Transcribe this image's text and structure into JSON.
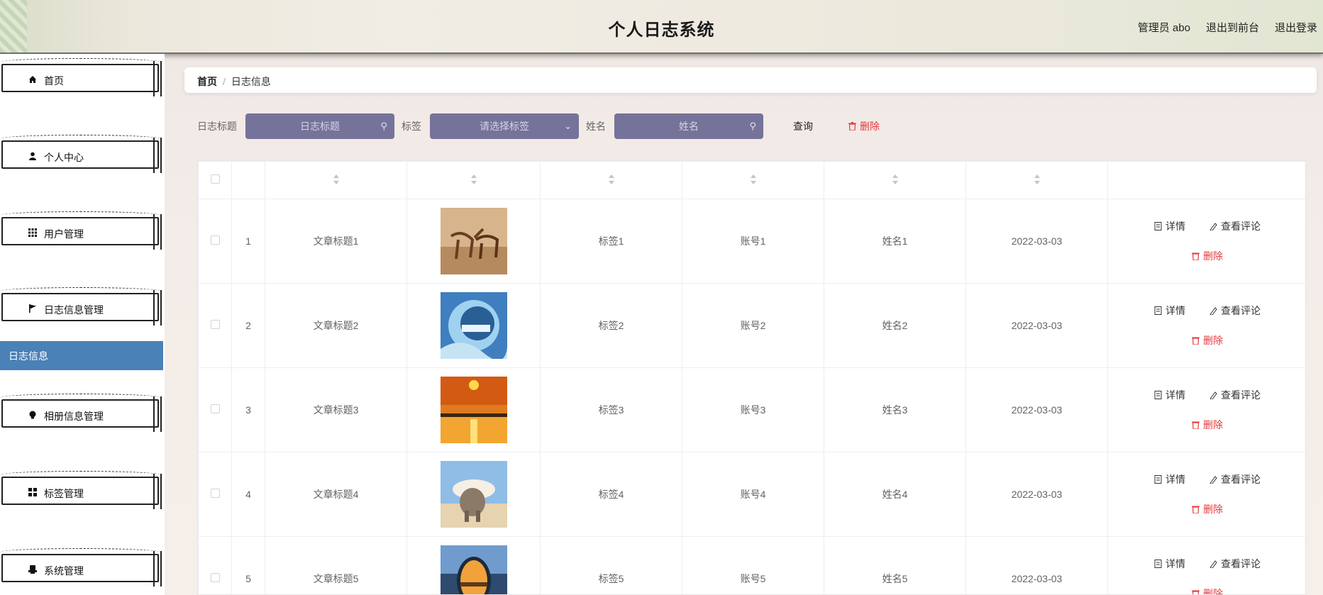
{
  "header": {
    "title": "个人日志系统",
    "user": "管理员 abo",
    "to_front": "退出到前台",
    "logout": "退出登录"
  },
  "sidebar": {
    "items": [
      {
        "label": "首页",
        "icon": "home-icon"
      },
      {
        "label": "个人中心",
        "icon": "user-icon"
      },
      {
        "label": "用户管理",
        "icon": "grid-icon"
      },
      {
        "label": "日志信息管理",
        "icon": "flag-icon"
      },
      {
        "label": "相册信息管理",
        "icon": "bulb-icon"
      },
      {
        "label": "标签管理",
        "icon": "apps-icon"
      },
      {
        "label": "系统管理",
        "icon": "print-icon"
      }
    ],
    "active_sub": "日志信息"
  },
  "breadcrumb": {
    "home": "首页",
    "sep": "/",
    "current": "日志信息"
  },
  "search": {
    "title_label": "日志标题",
    "title_placeholder": "日志标题",
    "tag_label": "标签",
    "tag_placeholder": "请选择标签",
    "name_label": "姓名",
    "name_placeholder": "姓名",
    "query": "查询",
    "delete": "删除"
  },
  "table": {
    "rows": [
      {
        "idx": "1",
        "title": "文章标题1",
        "image": "gazelles",
        "tag": "标签1",
        "account": "账号1",
        "name": "姓名1",
        "date": "2022-03-03"
      },
      {
        "idx": "2",
        "title": "文章标题2",
        "image": "water-wave",
        "tag": "标签2",
        "account": "账号2",
        "name": "姓名2",
        "date": "2022-03-03"
      },
      {
        "idx": "3",
        "title": "文章标题3",
        "image": "sunset-lake",
        "tag": "标签3",
        "account": "账号3",
        "name": "姓名3",
        "date": "2022-03-03"
      },
      {
        "idx": "4",
        "title": "文章标题4",
        "image": "elephant",
        "tag": "标签4",
        "account": "账号4",
        "name": "姓名4",
        "date": "2022-03-03"
      },
      {
        "idx": "5",
        "title": "文章标题5",
        "image": "mirror-sunset",
        "tag": "标签5",
        "account": "账号5",
        "name": "姓名5",
        "date": "2022-03-03"
      }
    ],
    "ops": {
      "detail": "详情",
      "comments": "查看评论",
      "delete": "删除"
    }
  },
  "colors": {
    "accent": "#4a81b6",
    "input_bg": "#75739a",
    "danger": "#e4393c"
  }
}
